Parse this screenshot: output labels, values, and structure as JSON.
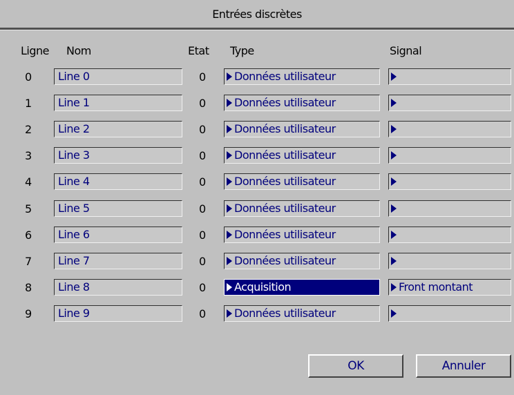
{
  "window": {
    "title": "Entrées discrètes"
  },
  "columns": {
    "line": "Ligne",
    "name": "Nom",
    "state": "Etat",
    "type": "Type",
    "signal": "Signal"
  },
  "rows": [
    {
      "line": "0",
      "name": "Line 0",
      "state": "0",
      "type": "Données utilisateur",
      "signal": ""
    },
    {
      "line": "1",
      "name": "Line 1",
      "state": "0",
      "type": "Données utilisateur",
      "signal": ""
    },
    {
      "line": "2",
      "name": "Line 2",
      "state": "0",
      "type": "Données utilisateur",
      "signal": ""
    },
    {
      "line": "3",
      "name": "Line 3",
      "state": "0",
      "type": "Données utilisateur",
      "signal": ""
    },
    {
      "line": "4",
      "name": "Line 4",
      "state": "0",
      "type": "Données utilisateur",
      "signal": ""
    },
    {
      "line": "5",
      "name": "Line 5",
      "state": "0",
      "type": "Données utilisateur",
      "signal": ""
    },
    {
      "line": "6",
      "name": "Line 6",
      "state": "0",
      "type": "Données utilisateur",
      "signal": ""
    },
    {
      "line": "7",
      "name": "Line 7",
      "state": "0",
      "type": "Données utilisateur",
      "signal": ""
    },
    {
      "line": "8",
      "name": "Line 8",
      "state": "0",
      "type": "Acquisition",
      "signal": "Front montant",
      "selected": true
    },
    {
      "line": "9",
      "name": "Line 9",
      "state": "0",
      "type": "Données utilisateur",
      "signal": ""
    }
  ],
  "buttons": {
    "ok": "OK",
    "cancel": "Annuler"
  },
  "colors": {
    "background": "#c0c0c0",
    "field_text": "#00007c",
    "selection": "#00007c"
  },
  "icons": {
    "dropdown": "right-triangle-icon"
  }
}
